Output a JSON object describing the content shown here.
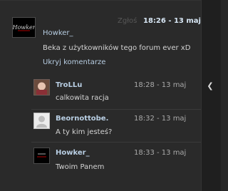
{
  "main_comment": {
    "report_label": "Zgłoś",
    "timestamp": "18:26 - 13 maj",
    "avatar_label": "Howker",
    "username": "Howker_",
    "text": "Beka z użytkowników tego forum ever xD",
    "hide_comments_label": "Ukryj komentarze"
  },
  "replies": [
    {
      "username": "TroLLu",
      "timestamp": "18:28 - 13 maj",
      "text": "calkowita racja"
    },
    {
      "username": "Beornottobe.",
      "timestamp": "18:32 - 13 maj",
      "text": "A ty kim jesteś?"
    },
    {
      "username": "Howker_",
      "timestamp": "18:33 - 13 maj",
      "text": "Twoim Panem"
    }
  ],
  "scrollbar": {
    "arrow_icon": "chevron-left-icon"
  }
}
